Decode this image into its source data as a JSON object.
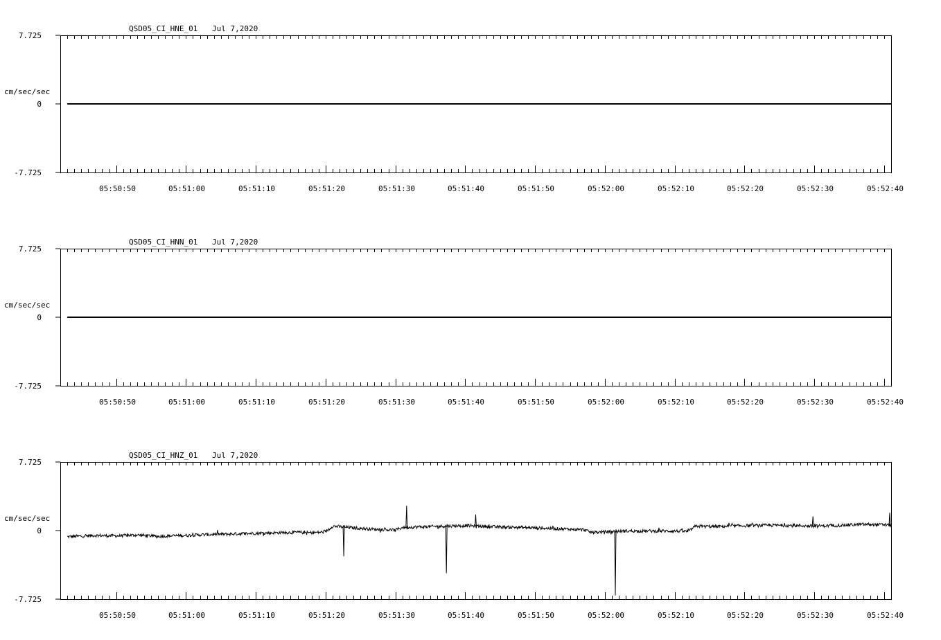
{
  "chart_data": [
    {
      "type": "line",
      "title": "QSD05_CI_HNE_01",
      "date": "Jul 7,2020",
      "ylabel": "cm/sec/sec",
      "ylim": [
        -7.725,
        7.725
      ],
      "yticks": [
        "7.725",
        "0",
        "-7.725"
      ],
      "xlim": [
        "05:50:42",
        "05:52:41"
      ],
      "xticks": [
        "05:50:50",
        "05:51:00",
        "05:51:10",
        "05:51:20",
        "05:51:30",
        "05:51:40",
        "05:51:50",
        "05:52:00",
        "05:52:10",
        "05:52:20",
        "05:52:30",
        "05:52:40"
      ],
      "grid": false,
      "series": [
        {
          "color": "#000000",
          "kind": "flat",
          "x": [
            "05:50:43",
            "05:52:41"
          ],
          "y": [
            0,
            0
          ]
        }
      ]
    },
    {
      "type": "line",
      "title": "QSD05_CI_HNN_01",
      "date": "Jul 7,2020",
      "ylabel": "cm/sec/sec",
      "ylim": [
        -7.725,
        7.725
      ],
      "yticks": [
        "7.725",
        "0",
        "-7.725"
      ],
      "xlim": [
        "05:50:42",
        "05:52:41"
      ],
      "xticks": [
        "05:50:50",
        "05:51:00",
        "05:51:10",
        "05:51:20",
        "05:51:30",
        "05:51:40",
        "05:51:50",
        "05:52:00",
        "05:52:10",
        "05:52:20",
        "05:52:30",
        "05:52:40"
      ],
      "grid": false,
      "series": [
        {
          "color": "#000000",
          "kind": "flat",
          "x": [
            "05:50:43",
            "05:52:41"
          ],
          "y": [
            0,
            0
          ]
        }
      ]
    },
    {
      "type": "line",
      "title": "QSD05_CI_HNZ_01",
      "date": "Jul 7,2020",
      "ylabel": "cm/sec/sec",
      "ylim": [
        -7.725,
        7.725
      ],
      "yticks": [
        "7.725",
        "0",
        "-7.725"
      ],
      "xlim": [
        "05:50:42",
        "05:52:41"
      ],
      "xticks": [
        "05:50:50",
        "05:51:00",
        "05:51:10",
        "05:51:20",
        "05:51:30",
        "05:51:40",
        "05:51:50",
        "05:52:00",
        "05:52:10",
        "05:52:20",
        "05:52:30",
        "05:52:40"
      ],
      "grid": false,
      "series": [
        {
          "color": "#000000",
          "kind": "noisy",
          "x": [
            "05:50:43",
            "05:50:47",
            "05:50:50",
            "05:50:53",
            "05:50:56",
            "05:51:00",
            "05:51:03",
            "05:51:06",
            "05:51:10",
            "05:51:13",
            "05:51:16",
            "05:51:18",
            "05:51:20",
            "05:51:21",
            "05:51:24",
            "05:51:27",
            "05:51:30",
            "05:51:31",
            "05:51:33",
            "05:51:37",
            "05:51:40",
            "05:51:42",
            "05:51:45",
            "05:51:48",
            "05:51:50",
            "05:51:57",
            "05:51:58",
            "05:52:00",
            "05:52:03",
            "05:52:06",
            "05:52:10",
            "05:52:12",
            "05:52:13",
            "05:52:16",
            "05:52:20",
            "05:52:24",
            "05:52:28",
            "05:52:30",
            "05:52:34",
            "05:52:37",
            "05:52:40",
            "05:52:41"
          ],
          "y": [
            -0.7,
            -0.55,
            -0.6,
            -0.5,
            -0.65,
            -0.55,
            -0.45,
            -0.4,
            -0.3,
            -0.25,
            -0.2,
            -0.25,
            -0.15,
            0.5,
            0.3,
            0.15,
            0.05,
            0.35,
            0.4,
            0.5,
            0.55,
            0.5,
            0.4,
            0.35,
            0.3,
            0.1,
            -0.2,
            -0.15,
            -0.05,
            -0.05,
            -0.05,
            -0.1,
            0.5,
            0.45,
            0.55,
            0.6,
            0.55,
            0.5,
            0.6,
            0.7,
            0.65,
            0.6
          ],
          "spikes": [
            {
              "x": "05:51:22.6",
              "y": -2.9
            },
            {
              "x": "05:51:31.6",
              "y": 2.8
            },
            {
              "x": "05:51:37.3",
              "y": -4.8
            },
            {
              "x": "05:51:41.5",
              "y": 1.8
            },
            {
              "x": "05:52:01.5",
              "y": -7.3
            },
            {
              "x": "05:52:29.8",
              "y": 1.6
            },
            {
              "x": "05:52:40.8",
              "y": 2.0
            }
          ]
        }
      ]
    }
  ]
}
